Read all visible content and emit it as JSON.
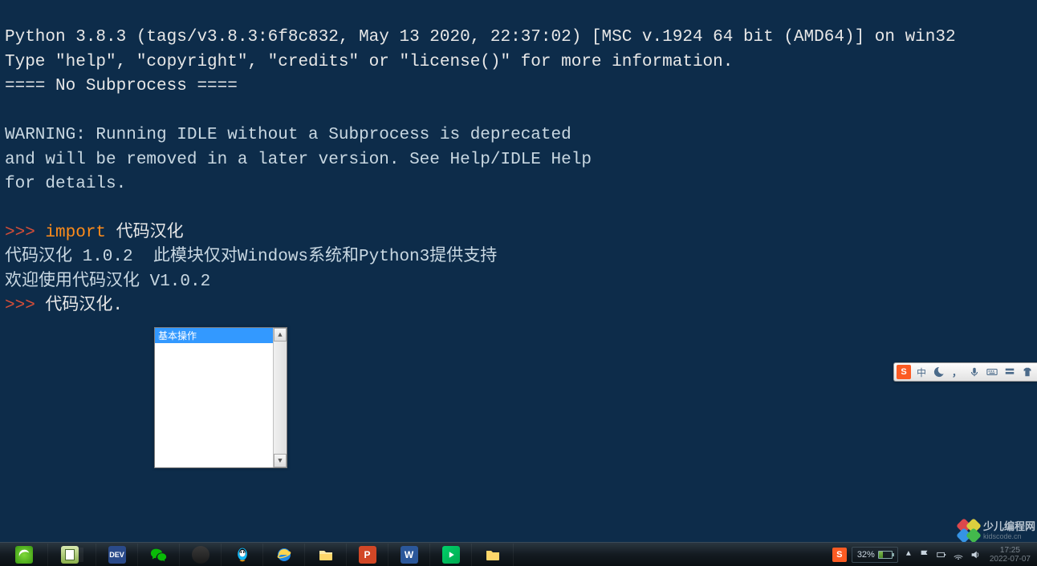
{
  "terminal": {
    "version_line": "Python 3.8.3 (tags/v3.8.3:6f8c832, May 13 2020, 22:37:02) [MSC v.1924 64 bit (AMD64)] on win32",
    "help_line": "Type \"help\", \"copyright\", \"credits\" or \"license()\" for more information.",
    "subprocess_line": "==== No Subprocess ====",
    "blank": "",
    "warn1": "WARNING: Running IDLE without a Subprocess is deprecated",
    "warn2": "and will be removed in a later version. See Help/IDLE Help",
    "warn3": "for details.",
    "prompt": ">>> ",
    "import_kw": "import",
    "import_mod": " 代码汉化",
    "out1": "代码汉化 1.0.2  此模块仅对Windows系统和Python3提供支持",
    "out2": "欢迎使用代码汉化 V1.0.2",
    "current_input": "代码汉化."
  },
  "autocomplete": {
    "items": [
      "基本操作"
    ]
  },
  "ime": {
    "logo": "S",
    "mode": "中"
  },
  "tray": {
    "battery_pct": "32%"
  },
  "clock": {
    "time": "17:25",
    "date": "2022-07-07"
  },
  "watermark": {
    "title": "少儿编程网",
    "sub": "kidscode.cn"
  },
  "taskbar": {
    "icons": [
      "ie",
      "notepadpp",
      "devcpp",
      "wechat",
      "qq",
      "ie2",
      "folder",
      "powerpoint",
      "word",
      "iqiyi",
      "folder2"
    ],
    "sogou": "S"
  }
}
